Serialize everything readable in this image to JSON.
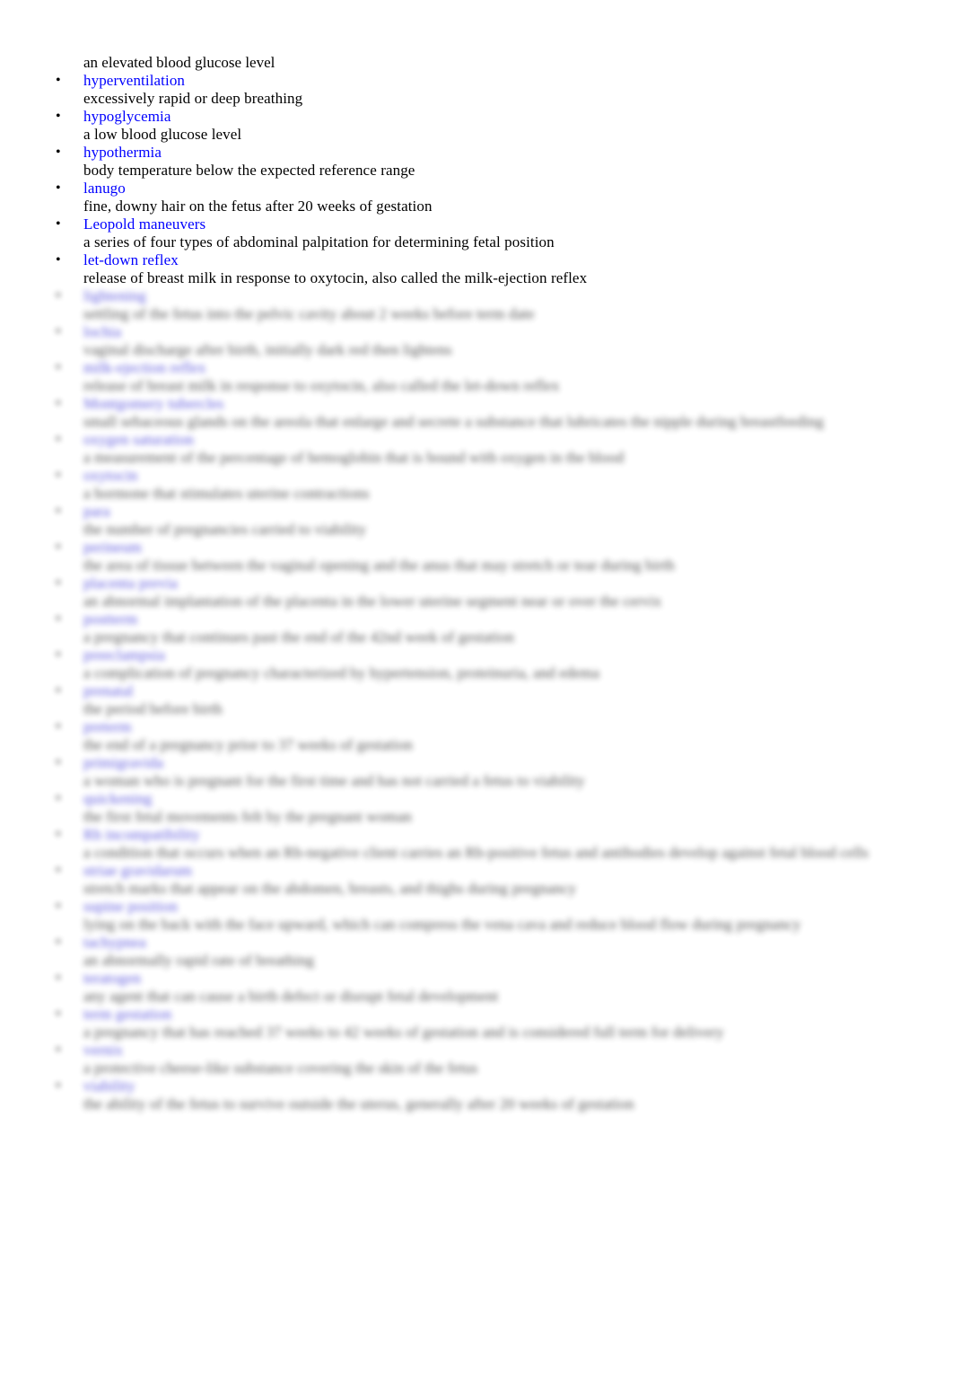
{
  "document": {
    "type": "glossary",
    "page_background": "#ffffff",
    "term_color": "#0000ff",
    "definition_color": "#000000",
    "bullet_glyph": "•",
    "legible_note": "Entries below 'lightening' are blurred and illegible in the source image."
  },
  "orphan_definition": "an elevated blood glucose level",
  "entries": [
    {
      "bullet": "•",
      "term": "hyperventilation",
      "definition": "excessively rapid or deep breathing",
      "blurred": false
    },
    {
      "bullet": "•",
      "term": "hypoglycemia",
      "definition": "a low blood glucose level",
      "blurred": false
    },
    {
      "bullet": "•",
      "term": "hypothermia",
      "definition": "body temperature below the expected reference range",
      "blurred": false
    },
    {
      "bullet": "•",
      "term": "lanugo",
      "definition": "fine, downy hair on the fetus after 20 weeks of gestation",
      "blurred": false
    },
    {
      "bullet": "•",
      "term": "Leopold maneuvers",
      "definition": "a series of four types of abdominal palpitation for determining fetal position",
      "blurred": false
    },
    {
      "bullet": "•",
      "term": "let-down reflex",
      "definition": "release of breast milk in response to oxytocin, also called the milk-ejection reflex",
      "blurred": false
    },
    {
      "bullet": "•",
      "term": "lightening",
      "definition": "settling of the fetus into the pelvic cavity about 2 weeks before term date",
      "blurred": true
    },
    {
      "bullet": "•",
      "term": "lochia",
      "definition": "vaginal discharge after birth, initially dark red then lightens",
      "blurred": true
    },
    {
      "bullet": "•",
      "term": "milk-ejection reflex",
      "definition": "release of breast milk in response to oxytocin, also called the let-down reflex",
      "blurred": true
    },
    {
      "bullet": "•",
      "term": "Montgomery tubercles",
      "definition": "small sebaceous glands on the areola that enlarge and secrete a substance that lubricates the nipple during breastfeeding",
      "blurred": true
    },
    {
      "bullet": "•",
      "term": "oxygen saturation",
      "definition": "a measurement of the percentage of hemoglobin that is bound with oxygen in the blood",
      "blurred": true
    },
    {
      "bullet": "•",
      "term": "oxytocin",
      "definition": "a hormone that stimulates uterine contractions",
      "blurred": true
    },
    {
      "bullet": "•",
      "term": "para",
      "definition": "the number of pregnancies carried to viability",
      "blurred": true
    },
    {
      "bullet": "•",
      "term": "perineum",
      "definition": "the area of tissue between the vaginal opening and the anus that may stretch or tear during birth",
      "blurred": true
    },
    {
      "bullet": "•",
      "term": "placenta previa",
      "definition": "an abnormal implantation of the placenta in the lower uterine segment near or over the cervix",
      "blurred": true
    },
    {
      "bullet": "•",
      "term": "postterm",
      "definition": "a pregnancy that continues past the end of the 42nd week of gestation",
      "blurred": true
    },
    {
      "bullet": "•",
      "term": "preeclampsia",
      "definition": "a complication of pregnancy characterized by hypertension, proteinuria, and edema",
      "blurred": true
    },
    {
      "bullet": "•",
      "term": "prenatal",
      "definition": "the period before birth",
      "blurred": true
    },
    {
      "bullet": "•",
      "term": "preterm",
      "definition": "the end of a pregnancy prior to 37 weeks of gestation",
      "blurred": true
    },
    {
      "bullet": "•",
      "term": "primigravida",
      "definition": "a woman who is pregnant for the first time and has not carried a fetus to viability",
      "blurred": true
    },
    {
      "bullet": "•",
      "term": "quickening",
      "definition": "the first fetal movements felt by the pregnant woman",
      "blurred": true
    },
    {
      "bullet": "•",
      "term": "Rh incompatibility",
      "definition": "a condition that occurs when an Rh-negative client carries an Rh-positive fetus and antibodies develop against fetal blood cells",
      "blurred": true
    },
    {
      "bullet": "•",
      "term": "striae gravidarum",
      "definition": "stretch marks that appear on the abdomen, breasts, and thighs during pregnancy",
      "blurred": true
    },
    {
      "bullet": "•",
      "term": "supine position",
      "definition": "lying on the back with the face upward, which can compress the vena cava and reduce blood flow during pregnancy",
      "blurred": true
    },
    {
      "bullet": "•",
      "term": "tachypnea",
      "definition": "an abnormally rapid rate of breathing",
      "blurred": true
    },
    {
      "bullet": "•",
      "term": "teratogen",
      "definition": "any agent that can cause a birth defect or disrupt fetal development",
      "blurred": true
    },
    {
      "bullet": "•",
      "term": "term gestation",
      "definition": "a pregnancy that has reached 37 weeks to 42 weeks of gestation and is considered full term for delivery",
      "blurred": true
    },
    {
      "bullet": "•",
      "term": "vernix",
      "definition": "a protective cheese-like substance covering the skin of the fetus",
      "blurred": true
    },
    {
      "bullet": "•",
      "term": "viability",
      "definition": "the ability of the fetus to survive outside the uterus, generally after 20 weeks of gestation",
      "blurred": true
    }
  ]
}
